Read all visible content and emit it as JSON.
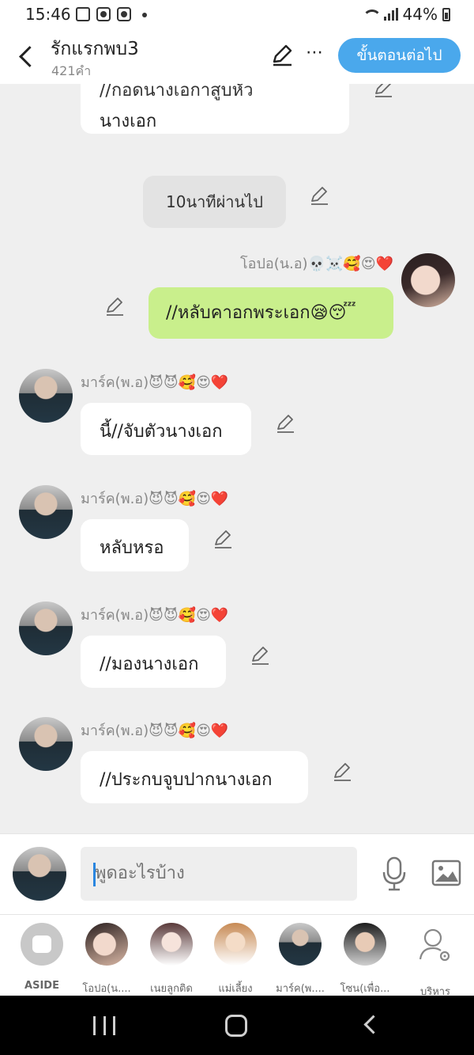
{
  "status_bar": {
    "time": "15:46",
    "battery": "44%"
  },
  "header": {
    "title": "รักแรกพบ3",
    "subtitle": "421คำ",
    "more_label": "⋯",
    "next_button": "ขั้นตอนต่อไป"
  },
  "chat": {
    "top_bubble_cut": "//กอดนางเอกาสูบหัว",
    "top_bubble": "นางเอก",
    "narration": "10นาทีผ่านไป",
    "mine": {
      "name": "โอปอ(น.อ)💀☠️🥰😍❤️",
      "text": "//หลับคาอกพระเอก😪😴"
    },
    "messages": [
      {
        "name": "มาร์ค(พ.อ)😈😈🥰😍❤️",
        "text": "นี้//จับตัวนางเอก"
      },
      {
        "name": "มาร์ค(พ.อ)😈😈🥰😍❤️",
        "text": "หลับหรอ"
      },
      {
        "name": "มาร์ค(พ.อ)😈😈🥰😍❤️",
        "text": "//มองนางเอก"
      },
      {
        "name": "มาร์ค(พ.อ)😈😈🥰😍❤️",
        "text": "//ประกบจูบปากนางเอก"
      }
    ]
  },
  "input": {
    "placeholder": "พูดอะไรบ้าง"
  },
  "characters": [
    {
      "label": "ASIDE"
    },
    {
      "label": "โอปอ(น...."
    },
    {
      "label": "เนยลูกติด"
    },
    {
      "label": "แม่เลี้ยง"
    },
    {
      "label": "มาร์ค(พ...."
    },
    {
      "label": "โซน(เพื่อ..."
    },
    {
      "label": "บริหาร"
    }
  ],
  "colors": {
    "accent": "#4aa8ec",
    "mine_bubble": "#c9ef8c",
    "narration_bg": "#e3e3e3",
    "background": "#efefef"
  }
}
